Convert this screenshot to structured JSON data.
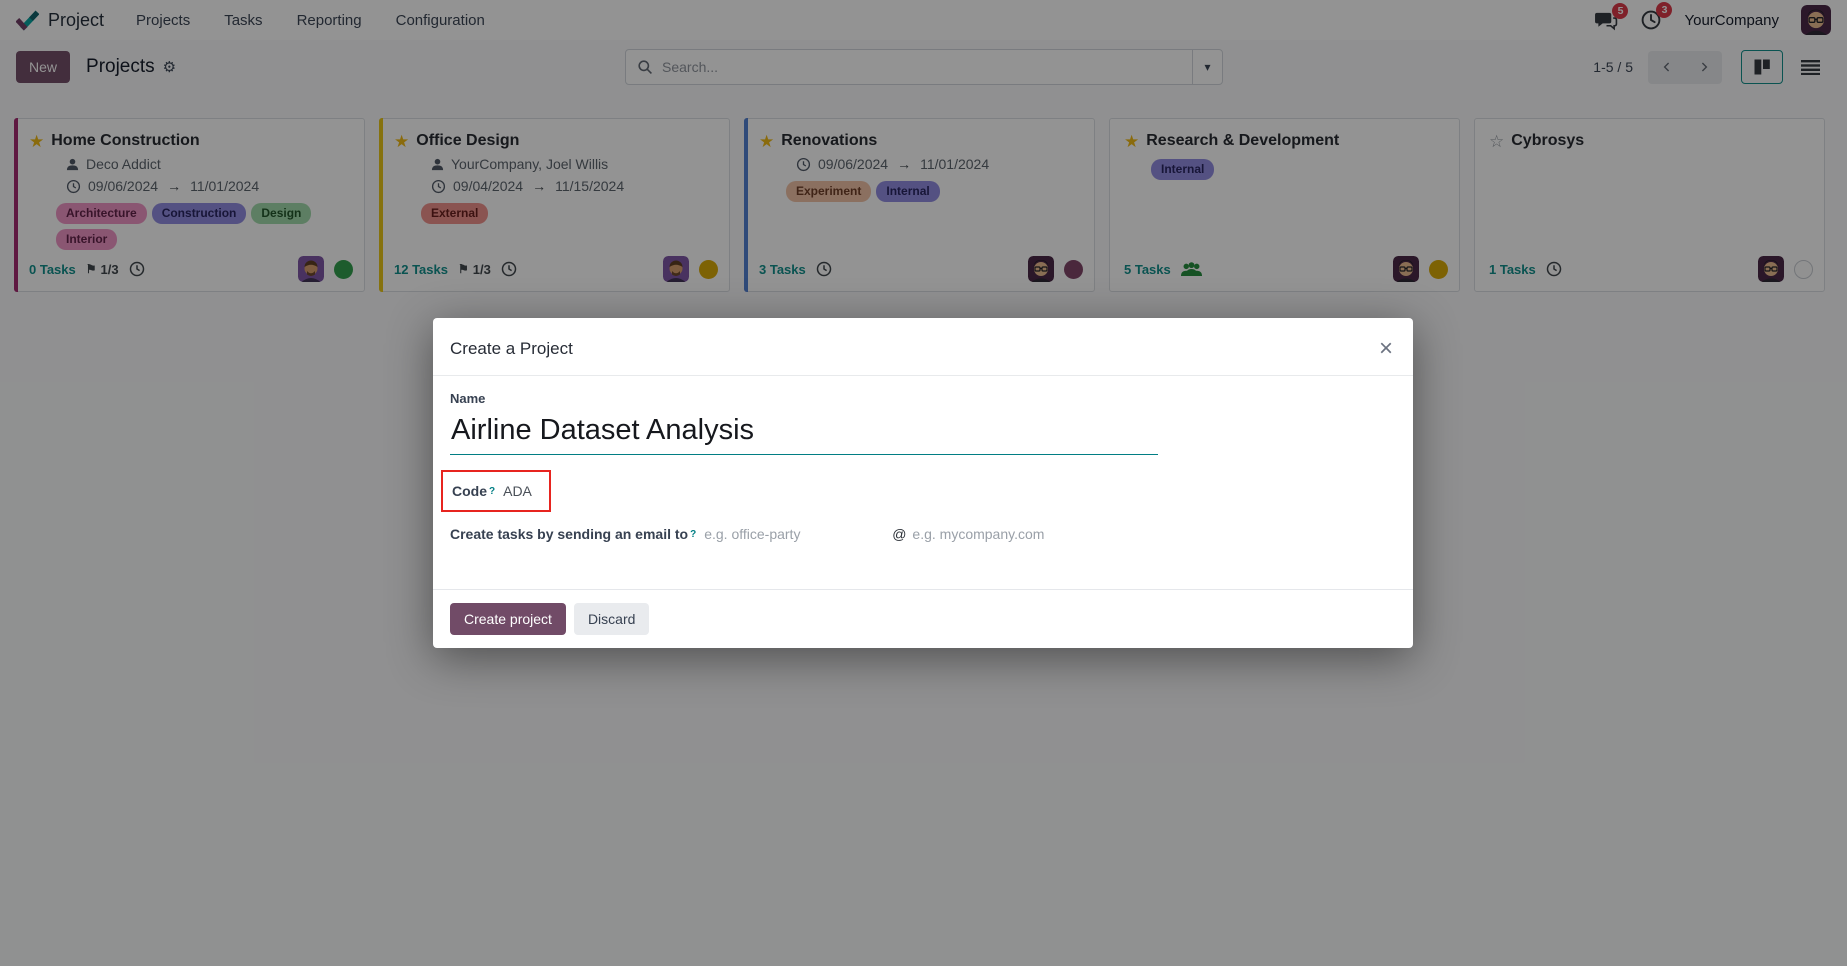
{
  "colors": {
    "brand_purple": "#714B67",
    "accent_teal": "#017e84",
    "badge_red": "#dc3545",
    "annotation_red": "#e7241f",
    "favorite_gold": "#efb810"
  },
  "icons": {
    "star_filled": "★",
    "star_outline": "☆",
    "flag": "⚑",
    "gear": "⚙",
    "arrow": "→",
    "caret": "▾",
    "close": "×",
    "at": "@"
  },
  "navbar": {
    "app_name": "Project",
    "menu_items": {
      "projects": "Projects",
      "tasks": "Tasks",
      "reporting": "Reporting",
      "configuration": "Configuration"
    },
    "messages_badge": "5",
    "activities_badge": "3",
    "company_name": "YourCompany"
  },
  "control_bar": {
    "new_button": "New",
    "title": "Projects",
    "search_placeholder": "Search...",
    "pager_text": "1-5 / 5"
  },
  "cards": [
    {
      "title": "Home Construction",
      "partner": "Deco Addict",
      "date_start": "09/06/2024",
      "date_end": "11/01/2024",
      "tags": [
        {
          "label": "Architecture",
          "bg": "#ef92c5",
          "fg": "#5e1e44"
        },
        {
          "label": "Construction",
          "bg": "#8f8ae0",
          "fg": "#24205e"
        },
        {
          "label": "Design",
          "bg": "#9fd9a9",
          "fg": "#1d5226"
        },
        {
          "label": "Interior",
          "bg": "#ef92c5",
          "fg": "#5e1e44"
        }
      ],
      "tasks_label": "0 Tasks",
      "milestone_ratio": "1/3",
      "status_color": "#2e9e49",
      "accent_color": "#a3246d"
    },
    {
      "title": "Office Design",
      "partner": "YourCompany, Joel Willis",
      "date_start": "09/04/2024",
      "date_end": "11/15/2024",
      "tags": [
        {
          "label": "External",
          "bg": "#ef8f8a",
          "fg": "#641a18"
        }
      ],
      "tasks_label": "12 Tasks",
      "milestone_ratio": "1/3",
      "status_color": "#d8a800",
      "accent_color": "#e8c513"
    },
    {
      "title": "Renovations",
      "date_start": "09/06/2024",
      "date_end": "11/01/2024",
      "tags": [
        {
          "label": "Experiment",
          "bg": "#f0c0a4",
          "fg": "#6b3a22"
        },
        {
          "label": "Internal",
          "bg": "#8f8ae0",
          "fg": "#24205e"
        }
      ],
      "tasks_label": "3 Tasks",
      "status_color": "#7d4165",
      "accent_color": "#4e7dd1"
    },
    {
      "title": "Research & Development",
      "tags": [
        {
          "label": "Internal",
          "bg": "#8f8ae0",
          "fg": "#24205e"
        }
      ],
      "tasks_label": "5 Tasks",
      "status_color": "#d8a800"
    },
    {
      "title": "Cybrosys",
      "tasks_label": "1 Tasks"
    }
  ],
  "modal": {
    "title": "Create a Project",
    "name_label": "Name",
    "name_value": "Airline Dataset Analysis",
    "code_label": "Code",
    "code_help": "?",
    "code_value": "ADA",
    "email_label": "Create tasks by sending an email to",
    "email_help": "?",
    "email_local_placeholder": "e.g. office-party",
    "email_domain_placeholder": "e.g. mycompany.com",
    "create_button": "Create project",
    "discard_button": "Discard"
  }
}
